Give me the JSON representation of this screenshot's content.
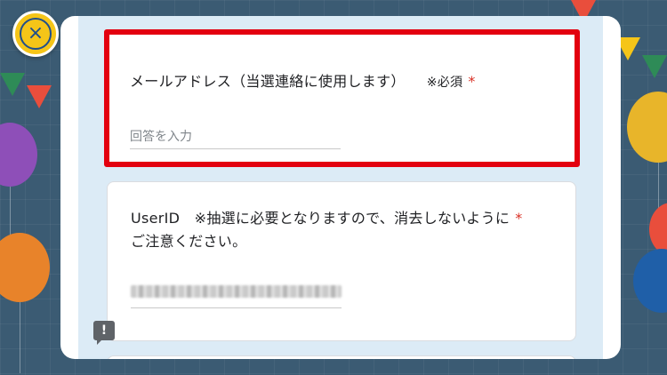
{
  "close_button": {
    "glyph": "×"
  },
  "email_question": {
    "title": "メールアドレス（当選連絡に使用します）",
    "note": "※必須",
    "required_mark": "*",
    "placeholder": "回答を入力"
  },
  "userid_question": {
    "title_line1": "UserID　※抽選に必要となりますので、消去しないように",
    "title_line2": "ご注意ください。",
    "required_mark": "*"
  },
  "feedback_button": {
    "glyph": "!"
  },
  "colors": {
    "highlight": "#e3000f",
    "required": "#d93025",
    "form_background": "#dcebf6",
    "close_button": "#f5c518"
  }
}
